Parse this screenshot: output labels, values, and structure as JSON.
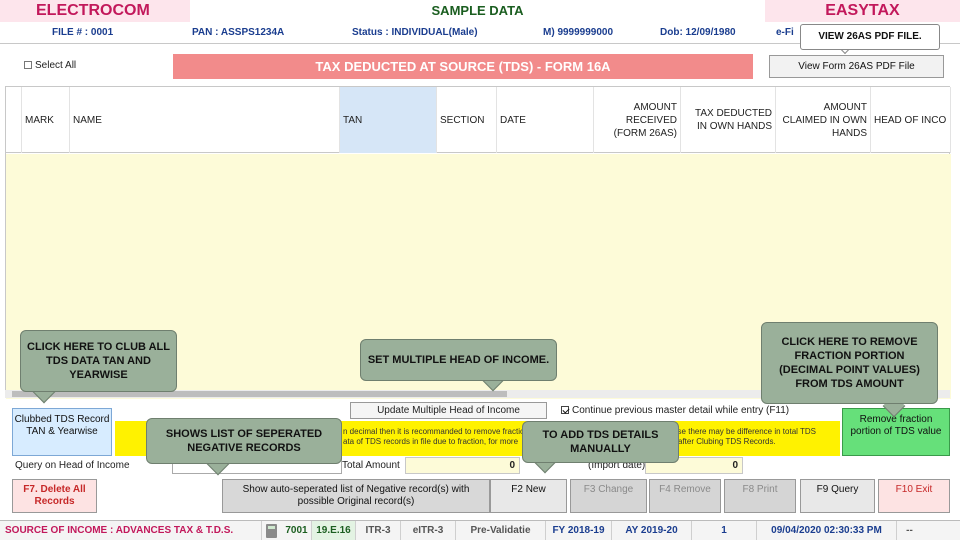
{
  "header": {
    "brand_left": "ELECTROCOM",
    "center_title": "SAMPLE DATA",
    "brand_right": "EASYTAX"
  },
  "info": {
    "file": "FILE # : 0001",
    "pan": "PAN : ASSPS1234A",
    "status": "Status : INDIVIDUAL(Male)",
    "mobile": "M) 9999999000",
    "dob": "Dob: 12/09/1980",
    "efiling": "e-Fi"
  },
  "toolbar": {
    "select_all": "Select All",
    "title": "TAX DEDUCTED AT SOURCE (TDS) - FORM 16A",
    "view_pdf": "View Form 26AS PDF File"
  },
  "grid": {
    "columns": {
      "mark": "MARK",
      "name": "NAME",
      "tan": "TAN",
      "section": "SECTION",
      "date": "DATE",
      "amount_received": "AMOUNT RECEIVED (FORM 26AS)",
      "tax_deducted": "TAX DEDUCTED IN OWN HANDS",
      "amount_claimed": "AMOUNT CLAIMED IN OWN HANDS",
      "head_of_income": "HEAD OF INCO"
    }
  },
  "actions": {
    "update_multi": "Update Multiple Head of Income",
    "continue_prev": "Continue previous master detail while entry (F11)",
    "clubbed": "Clubbed TDS Record TAN & Yearwise",
    "remove_fraction": "Remove fraction portion of TDS value",
    "msg_line1a": "n decimal then it is recommanded to remove fraction",
    "msg_line1b": "wise there may be difference in total TDS",
    "msg_line2a": "ata of TDS records in file due to fraction, for more",
    "msg_line2b": "after Clubing TDS Records.",
    "query_label": "Query on Head of Income",
    "total_label": "Total Amount",
    "total_val1": "0",
    "import_label": "(Import date)",
    "total_val2": "0"
  },
  "fkeys": {
    "f7": "F7. Delete All Records",
    "negative": "Show auto-seperated list of Negative record(s) with possible Original record(s)",
    "f2": "F2 New",
    "f3": "F3 Change",
    "f4": "F4 Remove",
    "f8": "F8 Print",
    "f9": "F9 Query",
    "f10": "F10 Exit"
  },
  "statusbar": {
    "source": "SOURCE OF INCOME : ADVANCES TAX & T.D.S.",
    "code": "7001",
    "version": "19.E.16",
    "itr": "ITR-3",
    "eitr": "eITR-3",
    "prevalidate": "Pre-Validatie",
    "fy": "FY 2018-19",
    "ay": "AY 2019-20",
    "count": "1",
    "datetime": "09/04/2020 02:30:33 PM",
    "end": "--"
  },
  "callouts": {
    "view26as": "VIEW 26AS PDF FILE.",
    "club": "CLICK HERE TO CLUB ALL TDS DATA TAN AND YEARWISE",
    "multi_head": "SET MULTIPLE HEAD OF INCOME.",
    "remove_fraction": "CLICK HERE TO REMOVE FRACTION PORTION (DECIMAL POINT VALUES) FROM TDS AMOUNT",
    "negative": "SHOWS LIST OF SEPERATED NEGATIVE RECORDS",
    "add_tds": "TO ADD TDS DETAILS MANUALLY"
  },
  "colors": {
    "accent_pink": "#c2185b",
    "title_bar": "#f28b8b",
    "grid_body": "#fdfbd8",
    "callout_bg": "#9ab09a",
    "remove_btn": "#66e07a",
    "clubbed_btn": "#d7ecff"
  }
}
